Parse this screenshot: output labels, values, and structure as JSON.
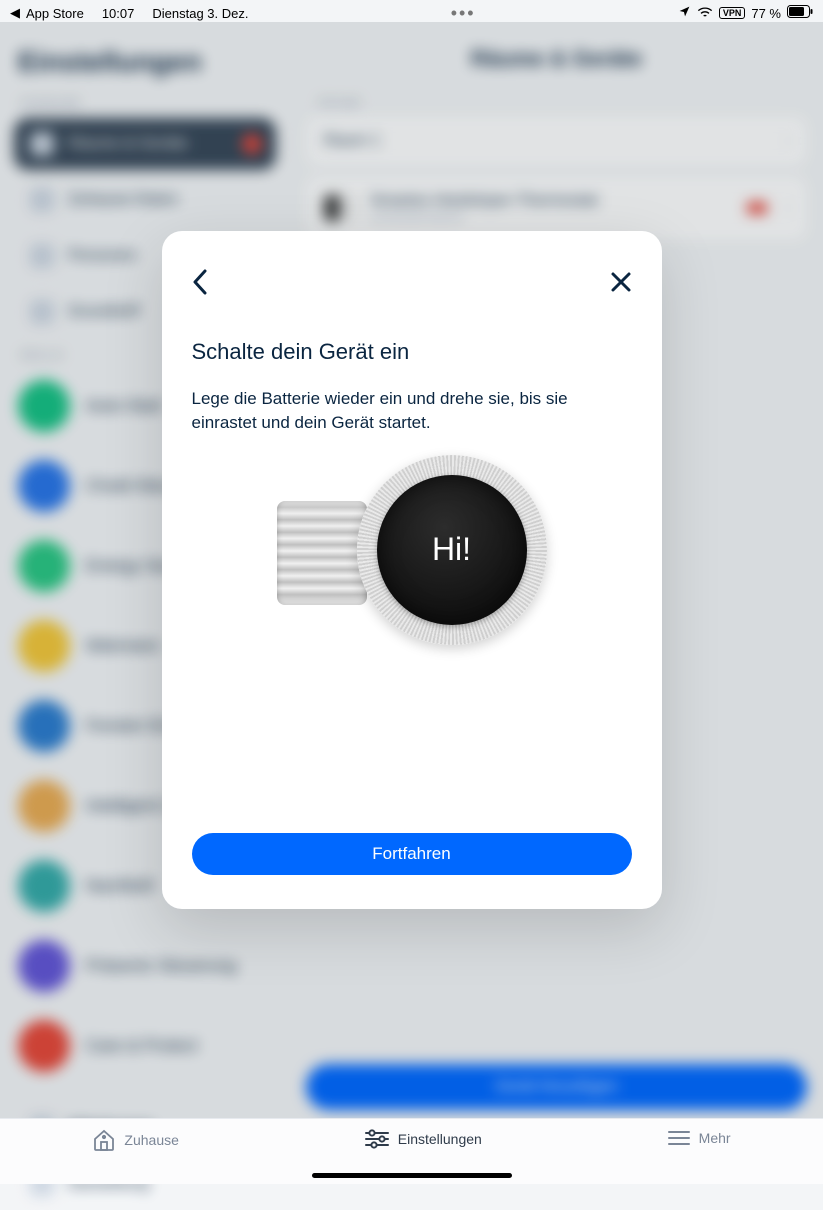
{
  "status": {
    "back_app": "App Store",
    "time": "10:07",
    "date": "Dienstag 3. Dez.",
    "battery": "77 %",
    "vpn": "VPN"
  },
  "sidebar": {
    "title": "Einstellungen",
    "section1_label": "Zuhause",
    "items1": [
      {
        "label": "Räume & Geräte",
        "active": true,
        "badge": true
      },
      {
        "label": "Zuhause-Daten"
      },
      {
        "label": "Personen"
      },
      {
        "label": "Grundrieff"
      }
    ],
    "section2_label": "Skills",
    "items2": [
      {
        "label": "Auto-Start",
        "color": "c-green"
      },
      {
        "label": "Chuld-Steuerun",
        "color": "c-blue"
      },
      {
        "label": "Energy Save",
        "color": "c-green2"
      },
      {
        "label": "Wärmeen",
        "color": "c-yellow"
      },
      {
        "label": "Fenster Erkennun",
        "color": "c-blue2"
      },
      {
        "label": "Intelligent Zeitplan",
        "color": "c-orange"
      },
      {
        "label": "Nachtluft",
        "color": "c-teal"
      },
      {
        "label": "Präsentz Steuerung",
        "color": "c-purple"
      },
      {
        "label": "Care & Protect",
        "color": "c-red"
      }
    ],
    "extra": [
      {
        "label": "Mitteilungen"
      },
      {
        "label": "Darstellung"
      }
    ]
  },
  "detail": {
    "title": "Räume & Geräte",
    "section": "RÄUME",
    "room": "Raum 1",
    "device_name": "Smartes Heizkörper-Thermostat",
    "device_sub": "connected device",
    "add_button": "Gerät hinzufügen"
  },
  "modal": {
    "title": "Schalte dein Gerät ein",
    "body": "Lege die Batterie wieder ein und drehe sie, bis sie einrastet und dein Gerät startet.",
    "dial_text": "Hi!",
    "continue": "Fortfahren"
  },
  "tabbar": {
    "home": "Zuhause",
    "settings": "Einstellungen",
    "more": "Mehr"
  }
}
